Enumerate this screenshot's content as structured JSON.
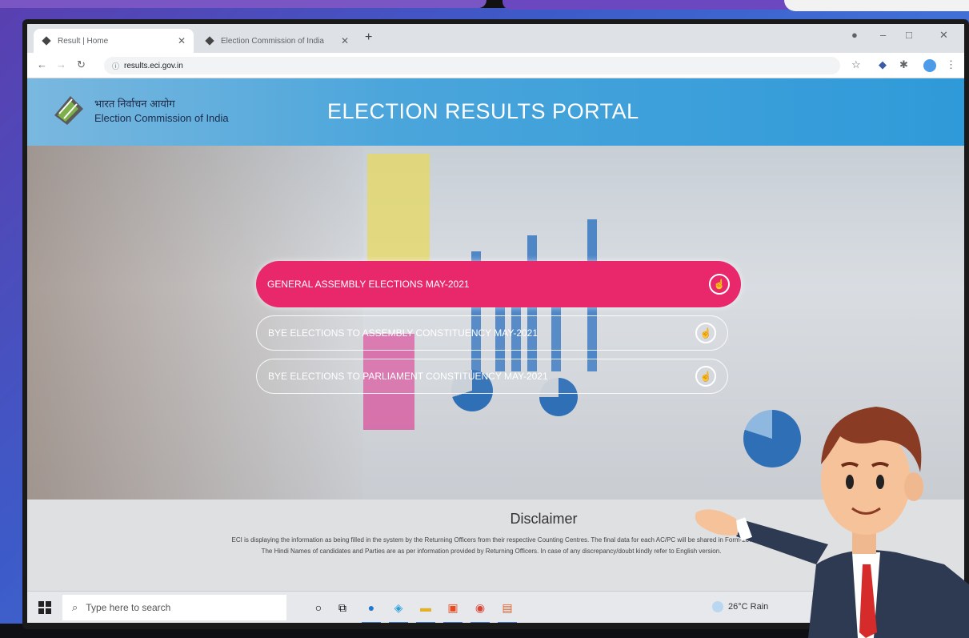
{
  "browser": {
    "tabs": [
      {
        "title": "Result | Home",
        "active": true
      },
      {
        "title": "Election Commission of India",
        "active": false
      }
    ],
    "new_tab_label": "+",
    "url": "results.eci.gov.in",
    "window_controls": {
      "minimize": "–",
      "maximize": "□",
      "close": "✕"
    }
  },
  "header": {
    "org_hindi": "भारत निर्वाचन आयोग",
    "org_english": "Election Commission of India",
    "title": "ELECTION RESULTS PORTAL"
  },
  "menu": [
    {
      "label": "GENERAL ASSEMBLY ELECTIONS MAY-2021",
      "icon": "hand-pointer-icon",
      "highlighted": true
    },
    {
      "label": "BYE ELECTIONS TO ASSEMBLY CONSTITUENCY MAY-2021",
      "icon": "hand-pointer-icon",
      "highlighted": false
    },
    {
      "label": "BYE ELECTIONS TO PARLIAMENT CONSTITUENCY MAY-2021",
      "icon": "hand-pointer-icon",
      "highlighted": false
    }
  ],
  "disclaimer": {
    "title": "Disclaimer",
    "text": "ECI is displaying the information as being filled in the system by the Returning Officers from their respective Counting Centres. The final data for each AC/PC will be shared in Form-20. The Hindi Names of candidates and Parties are as per information provided by Returning Officers. In case of any discrepancy/doubt kindly refer to English version."
  },
  "taskbar": {
    "search_placeholder": "Type here to search",
    "weather": "26°C  Rain"
  },
  "colors": {
    "header_blue": "#2f9ad9",
    "primary_button": "#e8286b",
    "background_purple": "#5a3fb0"
  }
}
